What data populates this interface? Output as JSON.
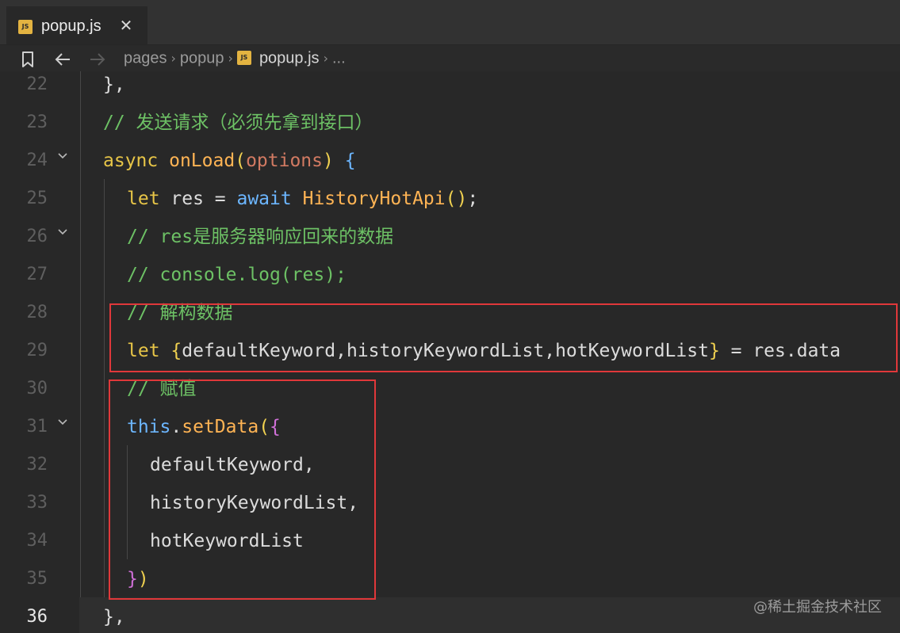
{
  "tab": {
    "icon_text": "JS",
    "label": "popup.js",
    "close": "✕"
  },
  "breadcrumb": {
    "bookmark_icon": "bookmark-icon",
    "back_icon": "arrow-left-icon",
    "forward_icon": "arrow-right-icon",
    "items": [
      "pages",
      "popup",
      "popup.js",
      "..."
    ],
    "file_icon_text": "JS"
  },
  "editor": {
    "active_line": "36",
    "lines": [
      {
        "n": "22",
        "fold": false,
        "tokens": [
          [
            "p",
            "},"
          ]
        ]
      },
      {
        "n": "23",
        "fold": false,
        "tokens": [
          [
            "c",
            "// "
          ],
          [
            "cc",
            "发送请求（必须先拿到接口）"
          ]
        ]
      },
      {
        "n": "24",
        "fold": true,
        "tokens": [
          [
            "ky",
            "async"
          ],
          [
            "p",
            " "
          ],
          [
            "f",
            "onLoad"
          ],
          [
            "b1",
            "("
          ],
          [
            "pm",
            "options"
          ],
          [
            "b1",
            ")"
          ],
          [
            "p",
            " "
          ],
          [
            "kb",
            "{"
          ]
        ]
      },
      {
        "n": "25",
        "fold": false,
        "tokens": [
          [
            "ky",
            "let"
          ],
          [
            "p",
            " res = "
          ],
          [
            "kb",
            "await"
          ],
          [
            "p",
            " "
          ],
          [
            "f",
            "HistoryHotApi"
          ],
          [
            "b1",
            "()"
          ],
          [
            "p",
            ";"
          ]
        ]
      },
      {
        "n": "26",
        "fold": true,
        "tokens": [
          [
            "c",
            "// res"
          ],
          [
            "cc",
            "是服务器响应回来的数据"
          ]
        ]
      },
      {
        "n": "27",
        "fold": false,
        "tokens": [
          [
            "c",
            "// console.log(res);"
          ]
        ]
      },
      {
        "n": "28",
        "fold": false,
        "tokens": [
          [
            "c",
            "// "
          ],
          [
            "cc",
            "解构数据"
          ]
        ]
      },
      {
        "n": "29",
        "fold": false,
        "tokens": [
          [
            "ky",
            "let"
          ],
          [
            "p",
            " "
          ],
          [
            "b1",
            "{"
          ],
          [
            "p",
            "defaultKeyword,historyKeywordList,hotKeywordList"
          ],
          [
            "b1",
            "}"
          ],
          [
            "p",
            " = res.data"
          ]
        ]
      },
      {
        "n": "30",
        "fold": false,
        "tokens": [
          [
            "c",
            "// "
          ],
          [
            "cc",
            "赋值"
          ]
        ]
      },
      {
        "n": "31",
        "fold": true,
        "tokens": [
          [
            "kb",
            "this"
          ],
          [
            "p",
            "."
          ],
          [
            "f",
            "setData"
          ],
          [
            "b1",
            "("
          ],
          [
            "b2",
            "{"
          ]
        ]
      },
      {
        "n": "32",
        "fold": false,
        "tokens": [
          [
            "p",
            "defaultKeyword,"
          ]
        ]
      },
      {
        "n": "33",
        "fold": false,
        "tokens": [
          [
            "p",
            "historyKeywordList,"
          ]
        ]
      },
      {
        "n": "34",
        "fold": false,
        "tokens": [
          [
            "p",
            "hotKeywordList"
          ]
        ]
      },
      {
        "n": "35",
        "fold": false,
        "tokens": [
          [
            "b2",
            "}"
          ],
          [
            "b1",
            ")"
          ]
        ]
      },
      {
        "n": "36",
        "fold": false,
        "tokens": [
          [
            "p",
            "},"
          ]
        ]
      }
    ]
  },
  "watermark": "@稀土掘金技术社区",
  "colors": {
    "highlight_box": "#e0383a",
    "keyword_yellow": "#e7c547",
    "keyword_blue": "#6cb6ff",
    "function": "#ffb454",
    "comment": "#6dc165"
  }
}
